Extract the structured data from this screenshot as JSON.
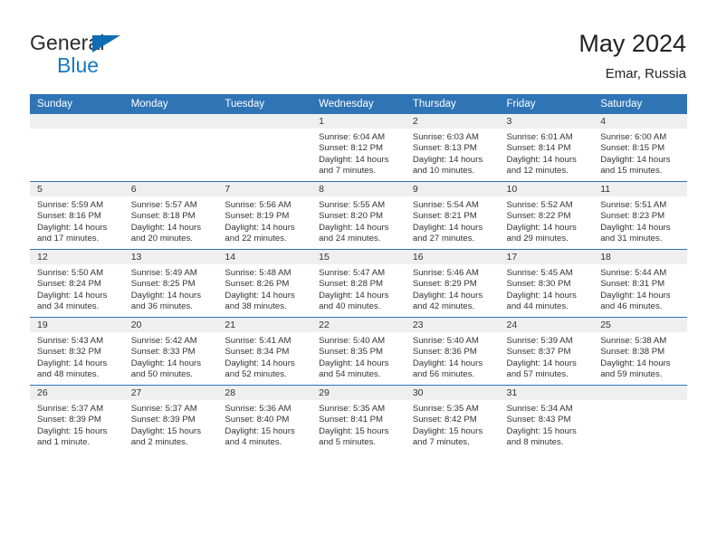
{
  "brand": {
    "name_part1": "General",
    "name_part2": "Blue",
    "color_primary": "#1878c0",
    "color_dark": "#2b2b2b",
    "triangle_icon": "triangle-icon"
  },
  "header": {
    "title": "May 2024",
    "subtitle": "Emar, Russia"
  },
  "theme": {
    "header_blue": "#2f74b5",
    "daynum_gray": "#efefef",
    "text": "#333333"
  },
  "weekdays": [
    "Sunday",
    "Monday",
    "Tuesday",
    "Wednesday",
    "Thursday",
    "Friday",
    "Saturday"
  ],
  "weeks": [
    [
      {
        "day": "",
        "lines": []
      },
      {
        "day": "",
        "lines": []
      },
      {
        "day": "",
        "lines": []
      },
      {
        "day": "1",
        "lines": [
          "Sunrise: 6:04 AM",
          "Sunset: 8:12 PM",
          "Daylight: 14 hours",
          "and 7 minutes."
        ]
      },
      {
        "day": "2",
        "lines": [
          "Sunrise: 6:03 AM",
          "Sunset: 8:13 PM",
          "Daylight: 14 hours",
          "and 10 minutes."
        ]
      },
      {
        "day": "3",
        "lines": [
          "Sunrise: 6:01 AM",
          "Sunset: 8:14 PM",
          "Daylight: 14 hours",
          "and 12 minutes."
        ]
      },
      {
        "day": "4",
        "lines": [
          "Sunrise: 6:00 AM",
          "Sunset: 8:15 PM",
          "Daylight: 14 hours",
          "and 15 minutes."
        ]
      }
    ],
    [
      {
        "day": "5",
        "lines": [
          "Sunrise: 5:59 AM",
          "Sunset: 8:16 PM",
          "Daylight: 14 hours",
          "and 17 minutes."
        ]
      },
      {
        "day": "6",
        "lines": [
          "Sunrise: 5:57 AM",
          "Sunset: 8:18 PM",
          "Daylight: 14 hours",
          "and 20 minutes."
        ]
      },
      {
        "day": "7",
        "lines": [
          "Sunrise: 5:56 AM",
          "Sunset: 8:19 PM",
          "Daylight: 14 hours",
          "and 22 minutes."
        ]
      },
      {
        "day": "8",
        "lines": [
          "Sunrise: 5:55 AM",
          "Sunset: 8:20 PM",
          "Daylight: 14 hours",
          "and 24 minutes."
        ]
      },
      {
        "day": "9",
        "lines": [
          "Sunrise: 5:54 AM",
          "Sunset: 8:21 PM",
          "Daylight: 14 hours",
          "and 27 minutes."
        ]
      },
      {
        "day": "10",
        "lines": [
          "Sunrise: 5:52 AM",
          "Sunset: 8:22 PM",
          "Daylight: 14 hours",
          "and 29 minutes."
        ]
      },
      {
        "day": "11",
        "lines": [
          "Sunrise: 5:51 AM",
          "Sunset: 8:23 PM",
          "Daylight: 14 hours",
          "and 31 minutes."
        ]
      }
    ],
    [
      {
        "day": "12",
        "lines": [
          "Sunrise: 5:50 AM",
          "Sunset: 8:24 PM",
          "Daylight: 14 hours",
          "and 34 minutes."
        ]
      },
      {
        "day": "13",
        "lines": [
          "Sunrise: 5:49 AM",
          "Sunset: 8:25 PM",
          "Daylight: 14 hours",
          "and 36 minutes."
        ]
      },
      {
        "day": "14",
        "lines": [
          "Sunrise: 5:48 AM",
          "Sunset: 8:26 PM",
          "Daylight: 14 hours",
          "and 38 minutes."
        ]
      },
      {
        "day": "15",
        "lines": [
          "Sunrise: 5:47 AM",
          "Sunset: 8:28 PM",
          "Daylight: 14 hours",
          "and 40 minutes."
        ]
      },
      {
        "day": "16",
        "lines": [
          "Sunrise: 5:46 AM",
          "Sunset: 8:29 PM",
          "Daylight: 14 hours",
          "and 42 minutes."
        ]
      },
      {
        "day": "17",
        "lines": [
          "Sunrise: 5:45 AM",
          "Sunset: 8:30 PM",
          "Daylight: 14 hours",
          "and 44 minutes."
        ]
      },
      {
        "day": "18",
        "lines": [
          "Sunrise: 5:44 AM",
          "Sunset: 8:31 PM",
          "Daylight: 14 hours",
          "and 46 minutes."
        ]
      }
    ],
    [
      {
        "day": "19",
        "lines": [
          "Sunrise: 5:43 AM",
          "Sunset: 8:32 PM",
          "Daylight: 14 hours",
          "and 48 minutes."
        ]
      },
      {
        "day": "20",
        "lines": [
          "Sunrise: 5:42 AM",
          "Sunset: 8:33 PM",
          "Daylight: 14 hours",
          "and 50 minutes."
        ]
      },
      {
        "day": "21",
        "lines": [
          "Sunrise: 5:41 AM",
          "Sunset: 8:34 PM",
          "Daylight: 14 hours",
          "and 52 minutes."
        ]
      },
      {
        "day": "22",
        "lines": [
          "Sunrise: 5:40 AM",
          "Sunset: 8:35 PM",
          "Daylight: 14 hours",
          "and 54 minutes."
        ]
      },
      {
        "day": "23",
        "lines": [
          "Sunrise: 5:40 AM",
          "Sunset: 8:36 PM",
          "Daylight: 14 hours",
          "and 56 minutes."
        ]
      },
      {
        "day": "24",
        "lines": [
          "Sunrise: 5:39 AM",
          "Sunset: 8:37 PM",
          "Daylight: 14 hours",
          "and 57 minutes."
        ]
      },
      {
        "day": "25",
        "lines": [
          "Sunrise: 5:38 AM",
          "Sunset: 8:38 PM",
          "Daylight: 14 hours",
          "and 59 minutes."
        ]
      }
    ],
    [
      {
        "day": "26",
        "lines": [
          "Sunrise: 5:37 AM",
          "Sunset: 8:39 PM",
          "Daylight: 15 hours",
          "and 1 minute."
        ]
      },
      {
        "day": "27",
        "lines": [
          "Sunrise: 5:37 AM",
          "Sunset: 8:39 PM",
          "Daylight: 15 hours",
          "and 2 minutes."
        ]
      },
      {
        "day": "28",
        "lines": [
          "Sunrise: 5:36 AM",
          "Sunset: 8:40 PM",
          "Daylight: 15 hours",
          "and 4 minutes."
        ]
      },
      {
        "day": "29",
        "lines": [
          "Sunrise: 5:35 AM",
          "Sunset: 8:41 PM",
          "Daylight: 15 hours",
          "and 5 minutes."
        ]
      },
      {
        "day": "30",
        "lines": [
          "Sunrise: 5:35 AM",
          "Sunset: 8:42 PM",
          "Daylight: 15 hours",
          "and 7 minutes."
        ]
      },
      {
        "day": "31",
        "lines": [
          "Sunrise: 5:34 AM",
          "Sunset: 8:43 PM",
          "Daylight: 15 hours",
          "and 8 minutes."
        ]
      },
      {
        "day": "",
        "lines": []
      }
    ]
  ]
}
